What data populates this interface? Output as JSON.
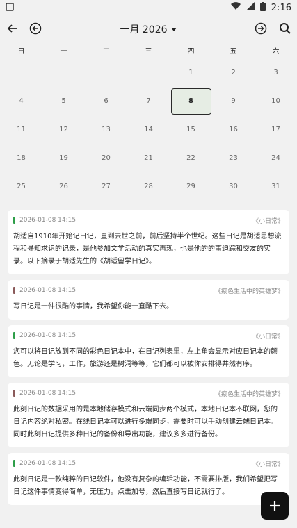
{
  "statusbar": {
    "time": "2:16"
  },
  "header": {
    "month": "一月 2026"
  },
  "weekdays": [
    "日",
    "一",
    "二",
    "三",
    "四",
    "五",
    "六"
  ],
  "calendar": {
    "selected": "8",
    "cells": [
      "",
      "",
      "",
      "",
      "1",
      "2",
      "3",
      "4",
      "5",
      "6",
      "7",
      "8",
      "9",
      "10",
      "11",
      "12",
      "13",
      "14",
      "15",
      "16",
      "17",
      "18",
      "19",
      "20",
      "21",
      "22",
      "23",
      "24",
      "25",
      "26",
      "27",
      "28",
      "29",
      "30",
      "31"
    ]
  },
  "colors": {
    "green": "#2e9e49",
    "brown": "#8a5a5a"
  },
  "entries": [
    {
      "date": "2026-01-08 14:15",
      "notebook": "《小日常》",
      "color": "#2e9e49",
      "text": "胡适自1910年开始记日记，直到去世之前，前后坚持半个世纪。这些日记是胡适思想流程和寻知求识的记录，是他参加文学活动的真实再现，也是他的的事迫踪和交友的实录。以下摘录于胡适先生的《胡适留学日记》。"
    },
    {
      "date": "2026-01-08 14:15",
      "notebook": "《瘀色生活中的英雄梦》",
      "color": "#8a5a5a",
      "text": "写日记是一件很酷的事情，我希望你能一直酷下去。"
    },
    {
      "date": "2026-01-08 14:15",
      "notebook": "《小日常》",
      "color": "#2e9e49",
      "text": "您可以将日记放到不同的彩色日记本中，在日记列表里，左上角会显示对应日记本的颜色。无论是学习，工作，旅游还是树洞等等，它们都可以被你安排得井然有序。"
    },
    {
      "date": "2026-01-08 14:15",
      "notebook": "《瘀色生活中的英雄梦》",
      "color": "#8a5a5a",
      "text": "此刻日记的数据采用的是本地储存模式和云端同步两个模式，本地日记本不联网，您的日记内容绝对私密。在线日记本可以进行多端同步，需要时可以手动创建云端日记本。同时此刻日记提供多种日记的备份和导出功能，建议多多进行备份。"
    },
    {
      "date": "2026-01-08 14:15",
      "notebook": "《小日常》",
      "color": "#2e9e49",
      "text": "此刻日记是一款纯粹的日记软件，他没有复杂的编辑功能，不需要排版，我们希望把写日记这件事情变得简单，无压力。点击加号，然后直接写日记就行了。"
    }
  ]
}
